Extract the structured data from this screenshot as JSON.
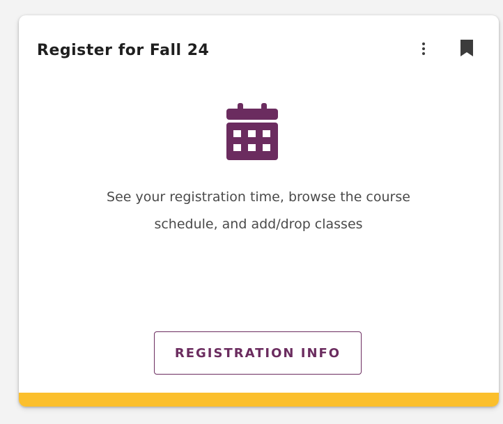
{
  "card": {
    "title": "Register for Fall 24",
    "menu_icon": "more-vertical-icon",
    "bookmark_icon": "bookmark-icon",
    "main_icon": "calendar-icon",
    "description": "See your registration time, browse the course schedule, and add/drop classes",
    "button_label": "REGISTRATION INFO"
  },
  "colors": {
    "brand": "#6b2c5f",
    "accent": "#fbbf2c",
    "icon_dark": "#3c3c3c"
  }
}
